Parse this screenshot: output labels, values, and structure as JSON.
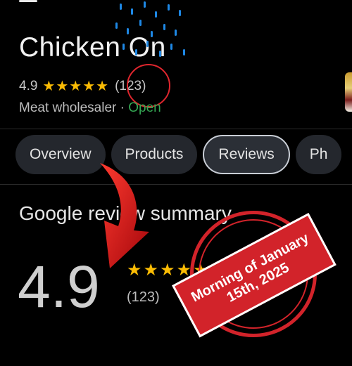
{
  "header": {
    "business_name": "Chicken On",
    "rating": "4.9",
    "stars": "★★★★★",
    "review_count": "(123)",
    "category": "Meat wholesaler",
    "separator": " · ",
    "status": "Open"
  },
  "tabs": [
    {
      "label": "Overview"
    },
    {
      "label": "Products"
    },
    {
      "label": "Reviews"
    },
    {
      "label": "Ph"
    }
  ],
  "review_summary": {
    "title": "Google review summary",
    "rating": "4.9",
    "stars": "★★★★★",
    "count": "(123)"
  },
  "stamp": {
    "text": "Morning of January 15th, 2025"
  },
  "colors": {
    "star": "#fbbc04",
    "open": "#34a853",
    "annotation_red": "#d2232a"
  },
  "icons": [
    "menu-icon",
    "star-icon",
    "arrow-annotation",
    "rain-overlay"
  ]
}
